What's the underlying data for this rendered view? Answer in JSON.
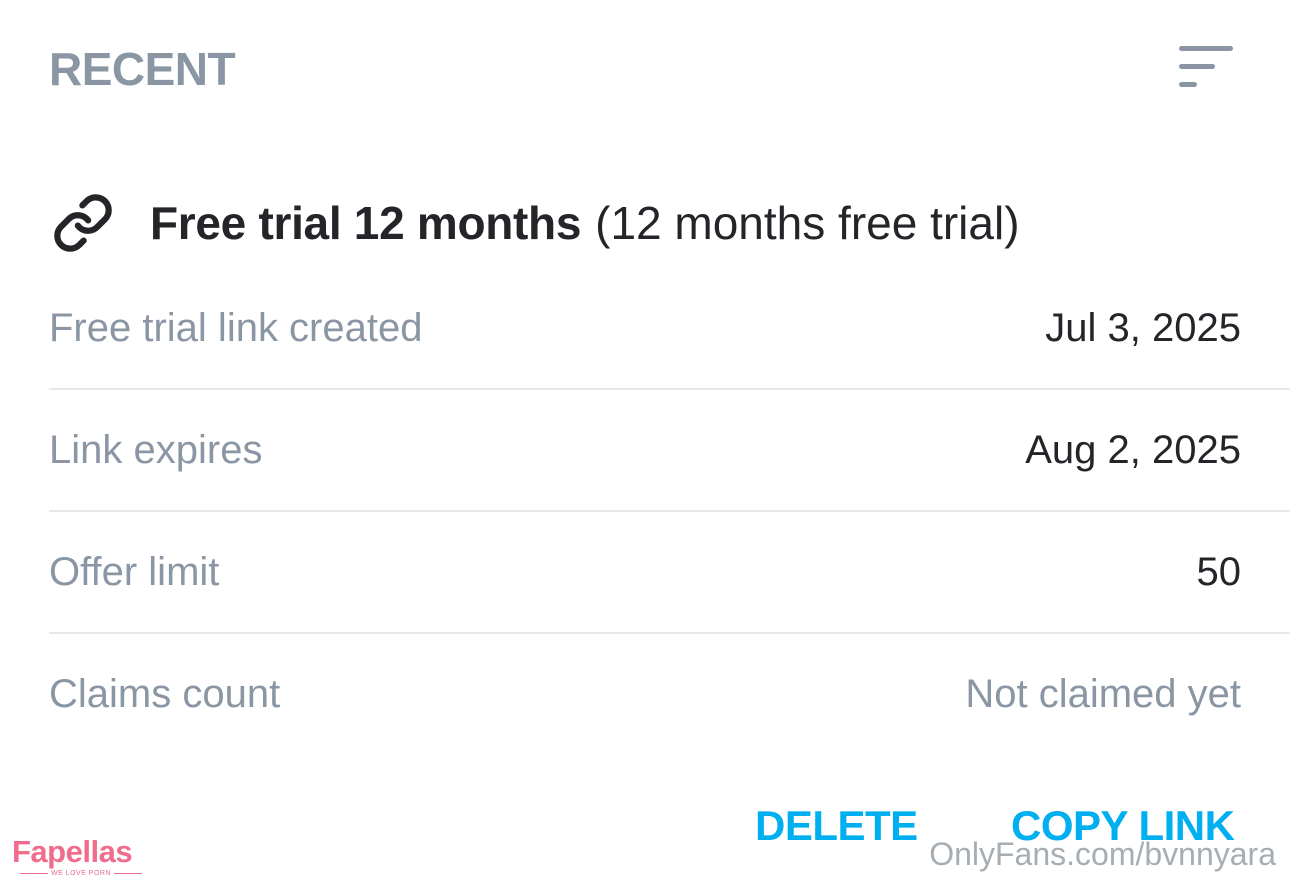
{
  "header": {
    "title": "RECENT",
    "sort_icon": "sort-filter-icon"
  },
  "offer": {
    "icon": "link-icon",
    "name": "Free trial 12 months",
    "subtitle": "(12 months free trial)"
  },
  "details": [
    {
      "label": "Free trial link created",
      "value": "Jul 3, 2025"
    },
    {
      "label": "Link expires",
      "value": "Aug 2, 2025"
    },
    {
      "label": "Offer limit",
      "value": "50"
    },
    {
      "label": "Claims count",
      "value": "Not claimed yet"
    }
  ],
  "actions": {
    "delete_label": "DELETE",
    "copy_label": "COPY LINK"
  },
  "watermark": {
    "logo": "Fapellas",
    "tagline": "WE LOVE PORN",
    "url": "OnlyFans.com/bvnnyara"
  },
  "colors": {
    "accent": "#00aff0",
    "muted_text": "#8a96a3",
    "primary_text": "#242529",
    "divider": "#e6e8ea",
    "watermark_pink": "#f06c8c"
  }
}
